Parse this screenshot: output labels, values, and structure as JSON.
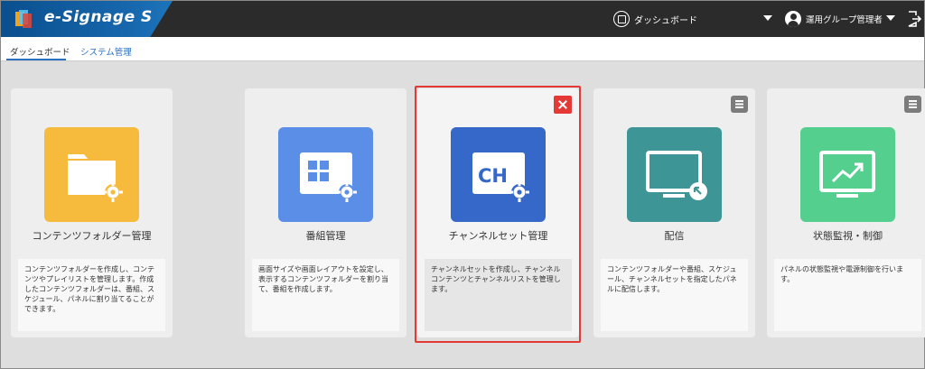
{
  "header": {
    "app_title": "e-Signage S",
    "dashboard_link": "ダッシュボード",
    "user_label": "運用グループ管理者",
    "colors": {
      "bar": "#2b2b2b",
      "brand": "#1767ad"
    }
  },
  "tabs": [
    {
      "label": "ダッシュボード",
      "active": true
    },
    {
      "label": "システム管理",
      "active": false
    }
  ],
  "cards": [
    {
      "label": "コンテンツフォルダー管理",
      "description": "コンテンツフォルダーを作成し、コンテンツやプレイリストを管理します。作成したコンテンツフォルダーは、番組、スケジュール、パネルに割り当てることができます。",
      "icon": "folder-gear-icon",
      "color": "#f6bb3c"
    },
    {
      "label": "番組管理",
      "description": "画面サイズや画面レイアウトを設定し、表示するコンテンツフォルダーを割り当て、番組を作成します。",
      "icon": "layout-gear-icon",
      "color": "#5b8ee6"
    },
    {
      "label": "チャンネルセット管理",
      "description": "チャンネルセットを作成し、チャンネルコンテンツとチャンネルリストを管理します。",
      "icon": "channel-gear-icon",
      "badge_text": "CH",
      "color": "#3568c8",
      "selected": true
    },
    {
      "label": "配信",
      "description": "コンテンツフォルダーや番組、スケジュール、チャンネルセットを指定したパネルに配信します。",
      "icon": "monitor-deliver-icon",
      "color": "#3d9596"
    },
    {
      "label": "状態監視・制御",
      "description": "パネルの状態監視や電源制御を行います。",
      "icon": "monitor-chart-icon",
      "color": "#55cf8e"
    }
  ]
}
